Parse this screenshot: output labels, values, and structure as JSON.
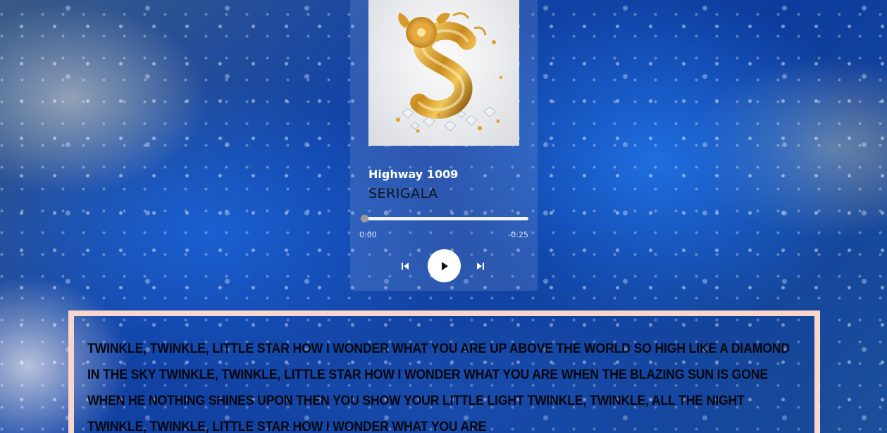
{
  "player": {
    "artist": "Highway 1009",
    "song_title": "SERIGALA",
    "time_elapsed": "0:00",
    "time_remaining": "-0:25",
    "progress": 0.0,
    "album_art": "golden-letter-s-with-rose-and-diamonds",
    "controls": {
      "prev_icon": "skip-previous-icon",
      "play_icon": "play-icon",
      "next_icon": "skip-next-icon"
    }
  },
  "lyrics": {
    "text": "TWINKLE, TWINKLE, LITTLE STAR HOW I WONDER WHAT YOU ARE UP ABOVE THE WORLD SO HIGH LIKE A DIAMOND IN THE SKY TWINKLE, TWINKLE, LITTLE STAR HOW I WONDER WHAT YOU ARE WHEN THE BLAZING SUN IS GONE WHEN HE NOTHING SHINES UPON THEN YOU SHOW YOUR LITTLE LIGHT TWINKLE, TWINKLE, ALL THE NIGHT TWINKLE, TWINKLE, LITTLE STAR HOW I WONDER WHAT YOU ARE"
  },
  "colors": {
    "lyrics_border": "#f9d7cc",
    "background": "#1244a8",
    "play_button": "#ffffff"
  }
}
